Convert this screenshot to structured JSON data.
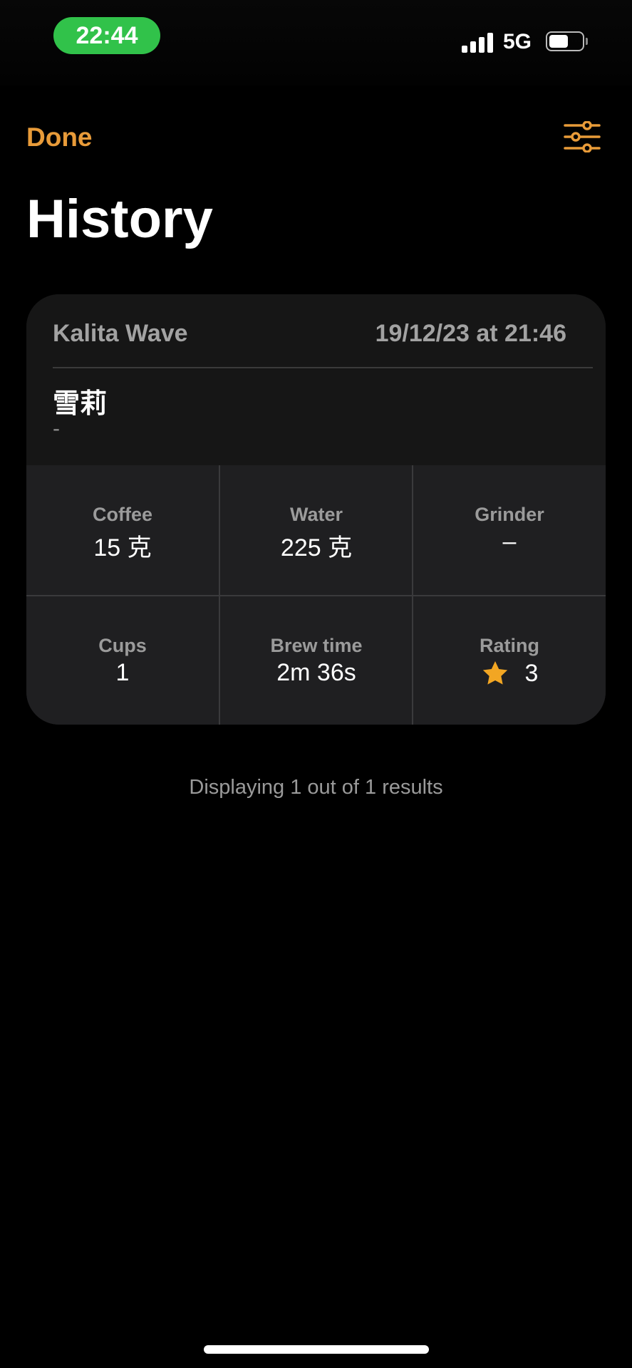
{
  "status_bar": {
    "time": "22:44",
    "network": "5G",
    "time_pill_color": "#31c24a"
  },
  "nav": {
    "done_label": "Done",
    "filter_icon": "sliders-icon",
    "accent_color": "#e89b39"
  },
  "page": {
    "title": "History"
  },
  "entry": {
    "method": "Kalita Wave",
    "datetime": "19/12/23 at 21:46",
    "bean_name": "雪莉",
    "bean_subtitle": "-",
    "stats": {
      "coffee": {
        "label": "Coffee",
        "value": "15 克"
      },
      "water": {
        "label": "Water",
        "value": "225 克"
      },
      "grinder": {
        "label": "Grinder",
        "value": "–"
      },
      "cups": {
        "label": "Cups",
        "value": "1"
      },
      "brew_time": {
        "label": "Brew time",
        "value": "2m 36s"
      },
      "rating": {
        "label": "Rating",
        "value": "3",
        "icon": "star-icon",
        "star_color": "#f2a623"
      }
    }
  },
  "footer": {
    "results_text": "Displaying 1 out of 1 results"
  }
}
